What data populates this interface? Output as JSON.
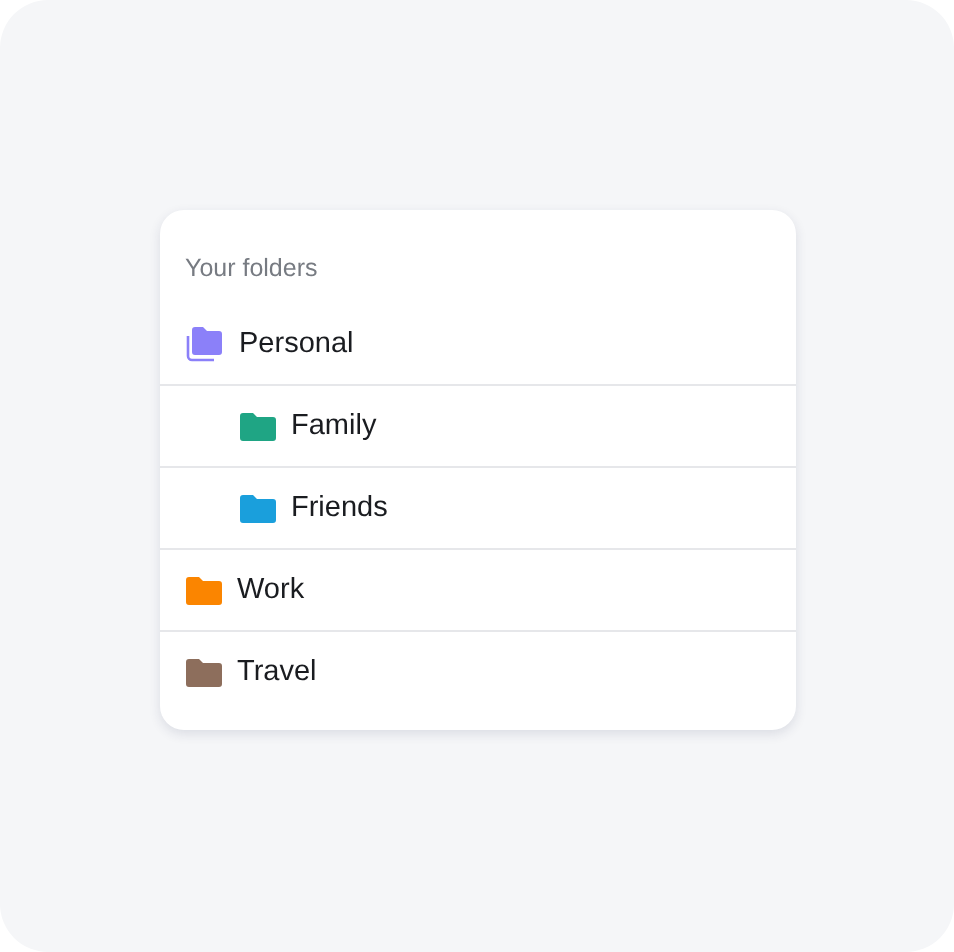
{
  "panel": {
    "title": "Your folders",
    "folders": [
      {
        "name": "Personal",
        "color": "#8b80f9",
        "children": [
          {
            "name": "Family",
            "color": "#1fa584"
          },
          {
            "name": "Friends",
            "color": "#1a9fdc"
          }
        ]
      },
      {
        "name": "Work",
        "color": "#fb8500"
      },
      {
        "name": "Travel",
        "color": "#8d6e5c"
      }
    ]
  }
}
